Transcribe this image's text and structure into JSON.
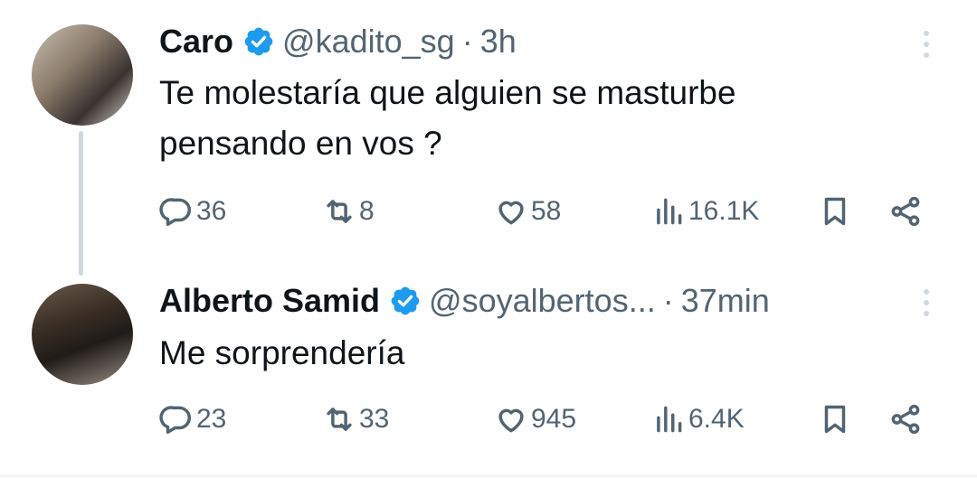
{
  "colors": {
    "verified": "#1d9bf0",
    "secondary_text": "#536471",
    "primary_text": "#0f1419",
    "thread_line": "#cfd9de"
  },
  "tweets": [
    {
      "name": "Caro",
      "handle": "@kadito_sg",
      "separator": "·",
      "time": "3h",
      "text_lines": [
        "Te molestaría que alguien se masturbe",
        "pensando en vos ?"
      ],
      "replies": "36",
      "retweets": "8",
      "likes": "58",
      "views": "16.1K"
    },
    {
      "name": "Alberto Samid",
      "handle": "@soyalbertos...",
      "separator": "·",
      "time": "37min",
      "text_lines": [
        "Me sorprendería"
      ],
      "replies": "23",
      "retweets": "33",
      "likes": "945",
      "views": "6.4K"
    }
  ],
  "icons": [
    "verified-badge-icon",
    "more-vertical-icon",
    "reply-icon",
    "retweet-icon",
    "like-icon",
    "views-icon",
    "bookmark-icon",
    "share-icon"
  ]
}
